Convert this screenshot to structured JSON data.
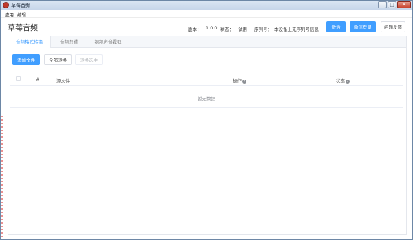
{
  "window": {
    "title": "草莓音频",
    "minimize_symbol": "–",
    "maximize_symbol": "□",
    "close_symbol": "✕"
  },
  "menu": {
    "items": [
      {
        "label": "应用"
      },
      {
        "label": "编辑"
      }
    ]
  },
  "header": {
    "app_title": "草莓音频",
    "version_label": "版本：",
    "version_value": "1.0.0",
    "status_label": "状态：",
    "status_value": "试用",
    "serial_label": "序列号：",
    "serial_value": "本设备上无序列号信息",
    "activate_button": "激活",
    "wechat_login_button": "微信登录",
    "feedback_button": "问题反馈"
  },
  "tabs": [
    {
      "label": "音频格式转换",
      "active": true
    },
    {
      "label": "音频剪辑",
      "active": false
    },
    {
      "label": "视频声音提取",
      "active": false
    }
  ],
  "toolbar": {
    "add_file_button": "添加文件",
    "convert_all_button": "全部转换",
    "converting_button": "转换选中"
  },
  "table": {
    "columns": {
      "index": "#",
      "source_file": "源文件",
      "operation": "操作",
      "status": "状态"
    },
    "help_icon_symbol": "?",
    "empty_text": "暂无数据"
  },
  "colors": {
    "accent": "#409eff",
    "title_bar": "#c7d6ea",
    "close_button": "#c8432e"
  }
}
